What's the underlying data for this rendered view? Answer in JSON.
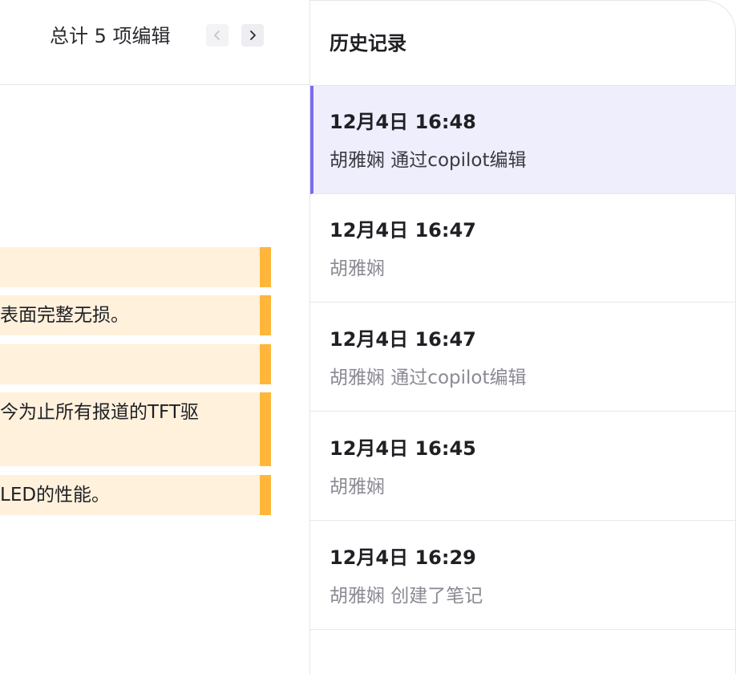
{
  "left": {
    "edit_count": "总计 5 项编辑",
    "diff_lines": [
      {
        "text": ""
      },
      {
        "text": "表面完整无损。"
      },
      {
        "text": ""
      },
      {
        "text": "今为止所有报道的TFT驱"
      },
      {
        "text": "LED的性能。"
      }
    ]
  },
  "history": {
    "title": "历史记录",
    "items": [
      {
        "time": "12月4日 16:48",
        "desc": "胡雅娴 通过copilot编辑"
      },
      {
        "time": "12月4日 16:47",
        "desc": "胡雅娴"
      },
      {
        "time": "12月4日 16:47",
        "desc": "胡雅娴 通过copilot编辑"
      },
      {
        "time": "12月4日 16:45",
        "desc": "胡雅娴"
      },
      {
        "time": "12月4日 16:29",
        "desc": "胡雅娴 创建了笔记"
      }
    ]
  },
  "colors": {
    "accent": "#7a6cf0",
    "active_bg": "#efeefc",
    "diff_bg": "#fff1dc",
    "diff_marker": "#ffb63a"
  },
  "icons": {
    "prev": "chevron-left-icon",
    "next": "chevron-right-icon"
  }
}
